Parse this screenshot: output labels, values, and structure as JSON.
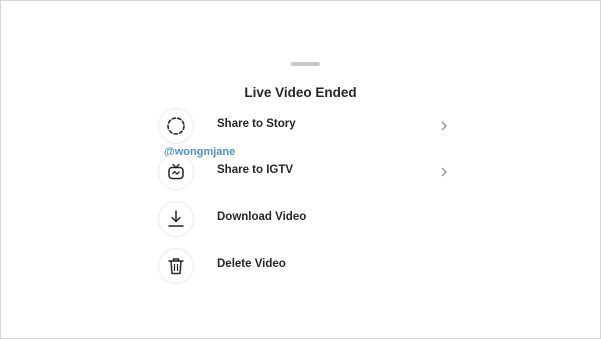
{
  "sheet": {
    "title": "Live Video Ended",
    "watermark": "@wongmjane",
    "items": [
      {
        "label": "Share to Story",
        "icon": "story-ring-icon",
        "has_chevron": true
      },
      {
        "label": "Share to IGTV",
        "icon": "igtv-icon",
        "has_chevron": true
      },
      {
        "label": "Download Video",
        "icon": "download-icon",
        "has_chevron": false
      },
      {
        "label": "Delete Video",
        "icon": "trash-icon",
        "has_chevron": false
      }
    ]
  },
  "colors": {
    "text": "#262626",
    "watermark": "#4a90c9",
    "chevron": "#8e8e8e",
    "grabber": "#c7c7c7"
  }
}
